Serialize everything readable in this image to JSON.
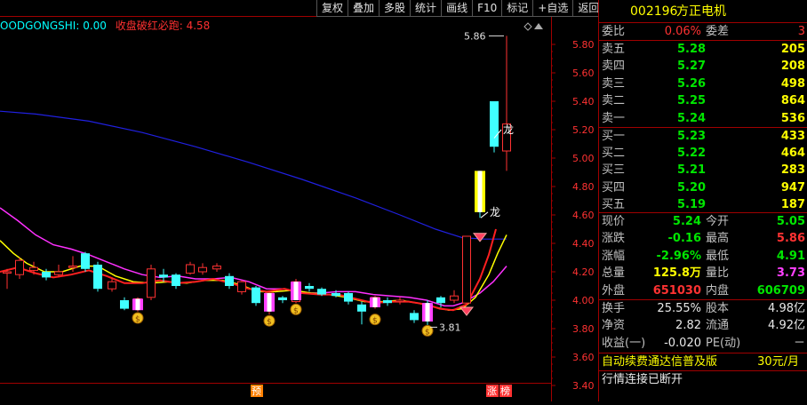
{
  "toolbar": {
    "buttons": [
      "复权",
      "叠加",
      "多股",
      "统计",
      "画线",
      "F10",
      "标记",
      "+自选",
      "返回"
    ]
  },
  "indicator": {
    "name1": "OODGONGSHI: 0.00",
    "name2": "收盘破红必跑: 4.58"
  },
  "chart_data": {
    "type": "candlestick",
    "y_axis_ticks": [
      "5.80",
      "5.60",
      "5.40",
      "5.20",
      "5.00",
      "4.80",
      "4.60",
      "4.40",
      "4.20",
      "4.00",
      "3.80",
      "3.60",
      "3.40"
    ],
    "ylim": [
      3.4,
      5.9
    ],
    "annotations": {
      "high_label": "5.86",
      "low_label": "3.81",
      "dragon1": "龙",
      "dragon2": "龙"
    },
    "bottom_markers": [
      "预",
      "涨",
      "榜"
    ]
  },
  "quote": {
    "code": "002196",
    "name": "方正电机",
    "weibi_label": "委比",
    "weibi_value": "0.06%",
    "weicha_label": "委差",
    "weicha_value": "3",
    "sell": [
      {
        "label": "卖五",
        "price": "5.28",
        "vol": "205"
      },
      {
        "label": "卖四",
        "price": "5.27",
        "vol": "208"
      },
      {
        "label": "卖三",
        "price": "5.26",
        "vol": "498"
      },
      {
        "label": "卖二",
        "price": "5.25",
        "vol": "864"
      },
      {
        "label": "卖一",
        "price": "5.24",
        "vol": "536"
      }
    ],
    "buy": [
      {
        "label": "买一",
        "price": "5.23",
        "vol": "433"
      },
      {
        "label": "买二",
        "price": "5.22",
        "vol": "464"
      },
      {
        "label": "买三",
        "price": "5.21",
        "vol": "283"
      },
      {
        "label": "买四",
        "price": "5.20",
        "vol": "947"
      },
      {
        "label": "买五",
        "price": "5.19",
        "vol": "187"
      }
    ],
    "stats": {
      "xianjia_label": "现价",
      "xianjia": "5.24",
      "jinkai_label": "今开",
      "jinkai": "5.05",
      "zhangdie_label": "涨跌",
      "zhangdie": "-0.16",
      "zuigao_label": "最高",
      "zuigao": "5.86",
      "zhangfu_label": "涨幅",
      "zhangfu": "-2.96%",
      "zuidi_label": "最低",
      "zuidi": "4.91",
      "zongliang_label": "总量",
      "zongliang": "125.8万",
      "liangbi_label": "量比",
      "liangbi": "3.73",
      "waipan_label": "外盘",
      "waipan": "651030",
      "neipan_label": "内盘",
      "neipan": "606709"
    },
    "fin": {
      "huanshou_label": "换手",
      "huanshou": "25.55%",
      "guben_label": "股本",
      "guben": "4.98亿",
      "jingzi_label": "净资",
      "jingzi": "2.82",
      "liutong_label": "流通",
      "liutong": "4.92亿",
      "shouyi_label": "收益(一)",
      "shouyi": "-0.020",
      "pe_label": "PE(动)",
      "pe": "－"
    },
    "promo": "自动续费通达信普及版",
    "promo_price": "30元/月",
    "status": "行情连接已断开"
  }
}
